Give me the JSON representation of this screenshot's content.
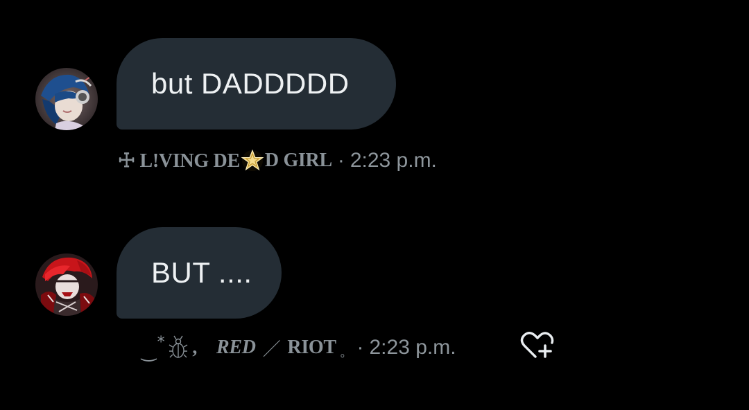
{
  "messages": [
    {
      "text": "but DADDDDD",
      "sender": {
        "part_a": "☩ L!VING DE",
        "star_icon": "golden-pentagram-emoji",
        "part_b": "D GIRL"
      },
      "separator": "·",
      "time": "2:23 p.m.",
      "avatar": "blue-haired-character-avatar"
    },
    {
      "text": "BUT ....",
      "sender": {
        "deco_wave": "‿",
        "deco_star": "*",
        "beetle_icon": "beetle-icon",
        "deco_comma": ",",
        "name_a": "RED",
        "slash": "／",
        "name_b": "RIOT",
        "tiny_dot": "。"
      },
      "separator": "·",
      "time": "2:23 p.m.",
      "avatar": "red-haired-character-avatar",
      "reaction_icon": "heart-plus-icon"
    }
  ],
  "colors": {
    "background": "#000000",
    "bubble": "#242d35",
    "bubble_text": "#eef1f3",
    "meta_text": "#8e969c",
    "star_gold": "#e7c25a"
  }
}
